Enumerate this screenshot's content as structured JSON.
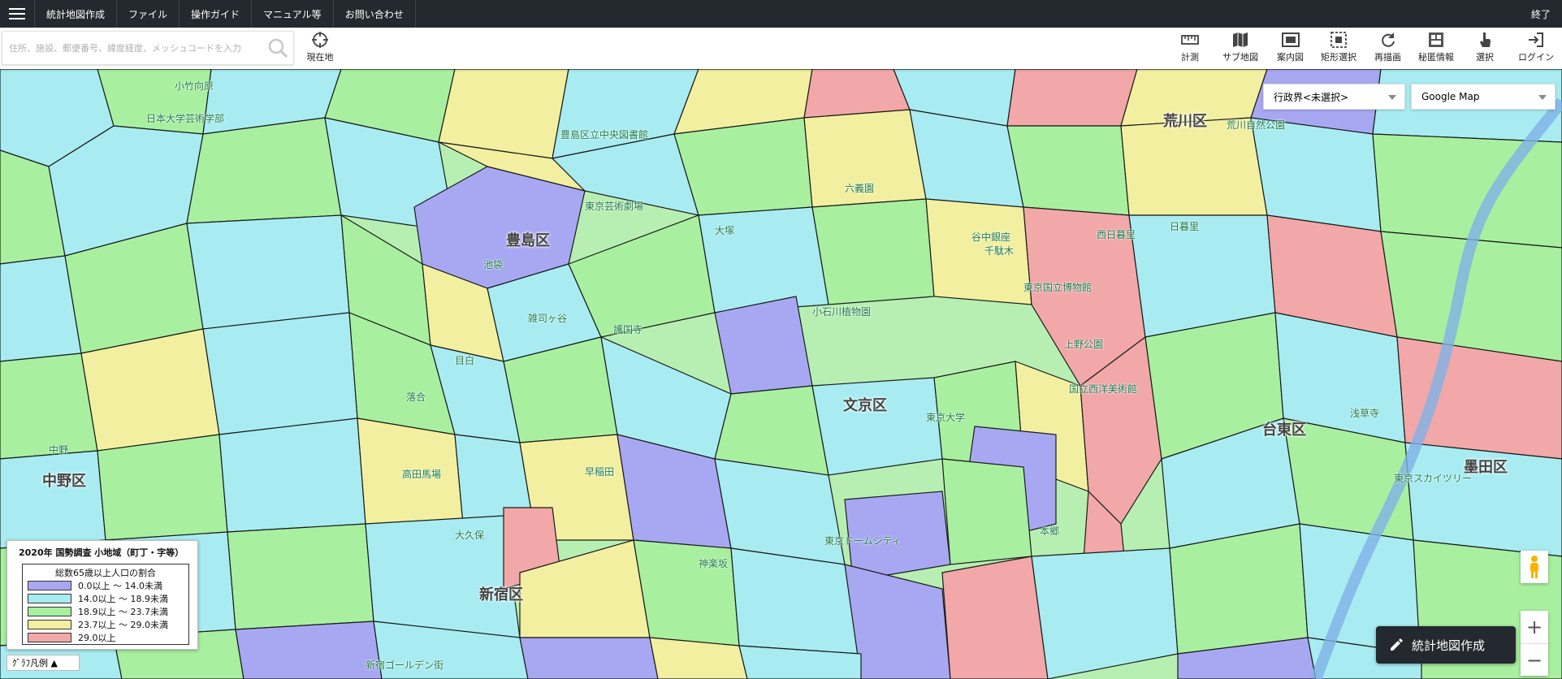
{
  "menubar": {
    "items": [
      "統計地図作成",
      "ファイル",
      "操作ガイド",
      "マニュアル等",
      "お問い合わせ"
    ],
    "exit_label": "終了"
  },
  "toolbar": {
    "search_placeholder": "住所、施設、郵便番号、緯度経度、メッシュコードを入力",
    "current_location_label": "現在地",
    "tools": [
      {
        "label": "計測",
        "icon": "ruler-icon"
      },
      {
        "label": "サブ地図",
        "icon": "map-icon"
      },
      {
        "label": "案内図",
        "icon": "guide-map-icon"
      },
      {
        "label": "矩形選択",
        "icon": "rectangle-select-icon"
      },
      {
        "label": "再描画",
        "icon": "refresh-icon"
      },
      {
        "label": "秘匿情報",
        "icon": "confidential-icon"
      },
      {
        "label": "選択",
        "icon": "pointer-hand-icon"
      },
      {
        "label": "ログイン",
        "icon": "login-icon"
      }
    ]
  },
  "map_controls": {
    "admin_boundary_select": "行政界<未選択>",
    "basemap_select": "Google Map"
  },
  "map_labels": {
    "wards": [
      "豊島区",
      "文京区",
      "台東区",
      "荒川区",
      "中野区",
      "新宿区",
      "墨田区"
    ],
    "places": [
      "小竹向原",
      "日本大学芸術学部",
      "豊島区立中央図書館",
      "東京芸術劇場",
      "六義園",
      "谷中銀座",
      "千駄木",
      "東京国立博物館",
      "国立西洋美術館",
      "上野公園",
      "東京大学",
      "小石川植物園",
      "東京ドームシティ",
      "早稲田",
      "神楽坂",
      "新宿ゴールデン街",
      "中野",
      "高田馬場",
      "護国寺",
      "東京スカイツリー",
      "浅草寺",
      "日暮里",
      "西日暮里",
      "荒川自然公園",
      "大塚",
      "池袋",
      "目白",
      "雑司ヶ谷",
      "落合",
      "大久保",
      "本郷"
    ]
  },
  "legend": {
    "title": "2020年 国勢調査 小地域（町丁・字等）",
    "subtitle": "総数65歳以上人口の割合",
    "items": [
      {
        "label": "0.0以上 ～ 14.0未満",
        "color": "#a8a8f2"
      },
      {
        "label": "14.0以上 ～ 18.9未満",
        "color": "#a8ecf2"
      },
      {
        "label": "18.9以上 ～ 23.7未満",
        "color": "#a8f0a0"
      },
      {
        "label": "23.7以上 ～ 29.0未満",
        "color": "#f2f0a0"
      },
      {
        "label": "29.0以上",
        "color": "#f2a8a8"
      }
    ],
    "graph_legend_label": "ｸﾞﾗﾌ凡例 ▲"
  },
  "create_button_label": "統計地図作成",
  "zoom": {
    "in": "+",
    "out": "−"
  }
}
